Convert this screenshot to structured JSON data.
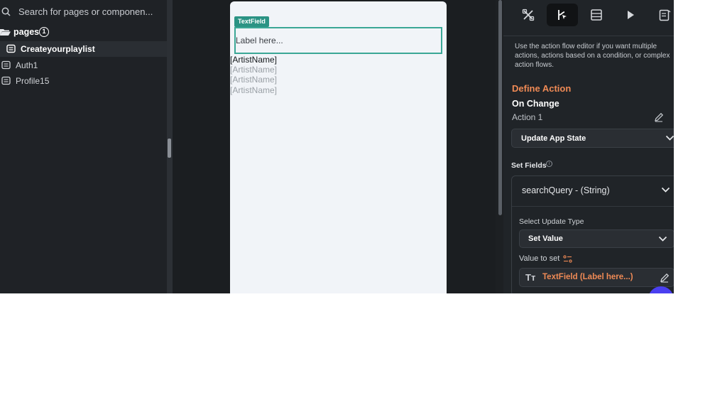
{
  "left_panel": {
    "search_placeholder": "Search for pages or componen...",
    "pages_label": "pages",
    "pages_count": "1",
    "pages": [
      {
        "label": "Createyourplaylist",
        "active": true
      },
      {
        "label": "Auth1",
        "active": false
      },
      {
        "label": "Profile15",
        "active": false
      }
    ]
  },
  "canvas": {
    "textfield_tag": "TextField",
    "textfield_label": "Label here...",
    "artist_rows": [
      "[ArtistName]",
      "[ArtistName]",
      "[ArtistName]",
      "[ArtistName]"
    ]
  },
  "right_panel": {
    "tabs": [
      {
        "icon": "tools-icon",
        "active": false
      },
      {
        "icon": "action-flow-icon",
        "active": true
      },
      {
        "icon": "layers-icon",
        "active": false
      },
      {
        "icon": "play-icon",
        "active": false
      },
      {
        "icon": "notes-icon",
        "active": false
      }
    ],
    "help_text": "Use the action flow editor if you want multiple actions, actions based on a condition, or complex action flows.",
    "define_action": "Define Action",
    "trigger": "On Change",
    "action_label": "Action 1",
    "action_type": "Update App State",
    "set_fields_label": "Set Fields",
    "field_name": "searchQuery - (String)",
    "update_type_label": "Select Update Type",
    "update_type_value": "Set Value",
    "value_to_set_label": "Value to set",
    "value_icon_text": "Tт",
    "value_source": "TextField (Label here...)"
  },
  "colors": {
    "accent_orange": "#ef8a55",
    "accent_teal": "#3ba796",
    "fab_purple": "#4a3ff0"
  }
}
